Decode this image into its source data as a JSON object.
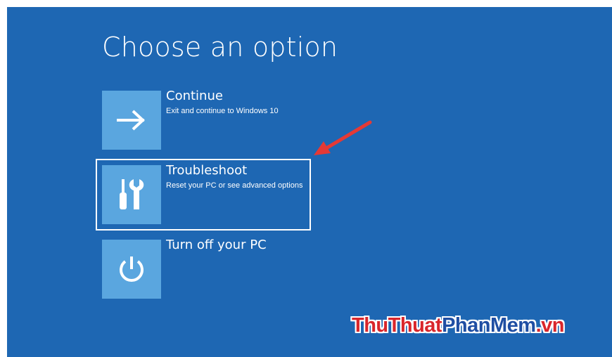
{
  "title": "Choose an option",
  "options": [
    {
      "label": "Continue",
      "description": "Exit and continue to Windows 10",
      "icon": "arrow-right-icon"
    },
    {
      "label": "Troubleshoot",
      "description": "Reset your PC or see advanced options",
      "icon": "tools-icon"
    },
    {
      "label": "Turn off your PC",
      "description": "",
      "icon": "power-icon"
    }
  ],
  "selected_option": "Troubleshoot",
  "annotation": {
    "type": "red-arrow",
    "points_to": "Troubleshoot"
  },
  "watermark": {
    "part1": "ThuThuat",
    "part2": "PhanMem",
    "part3": ".vn"
  },
  "colors": {
    "background": "#1e67b3",
    "tile": "#5aa6df",
    "text": "#ffffff",
    "annotation_arrow": "#e53935",
    "watermark_red": "#d9262b",
    "watermark_blue": "#1f4ea3"
  }
}
